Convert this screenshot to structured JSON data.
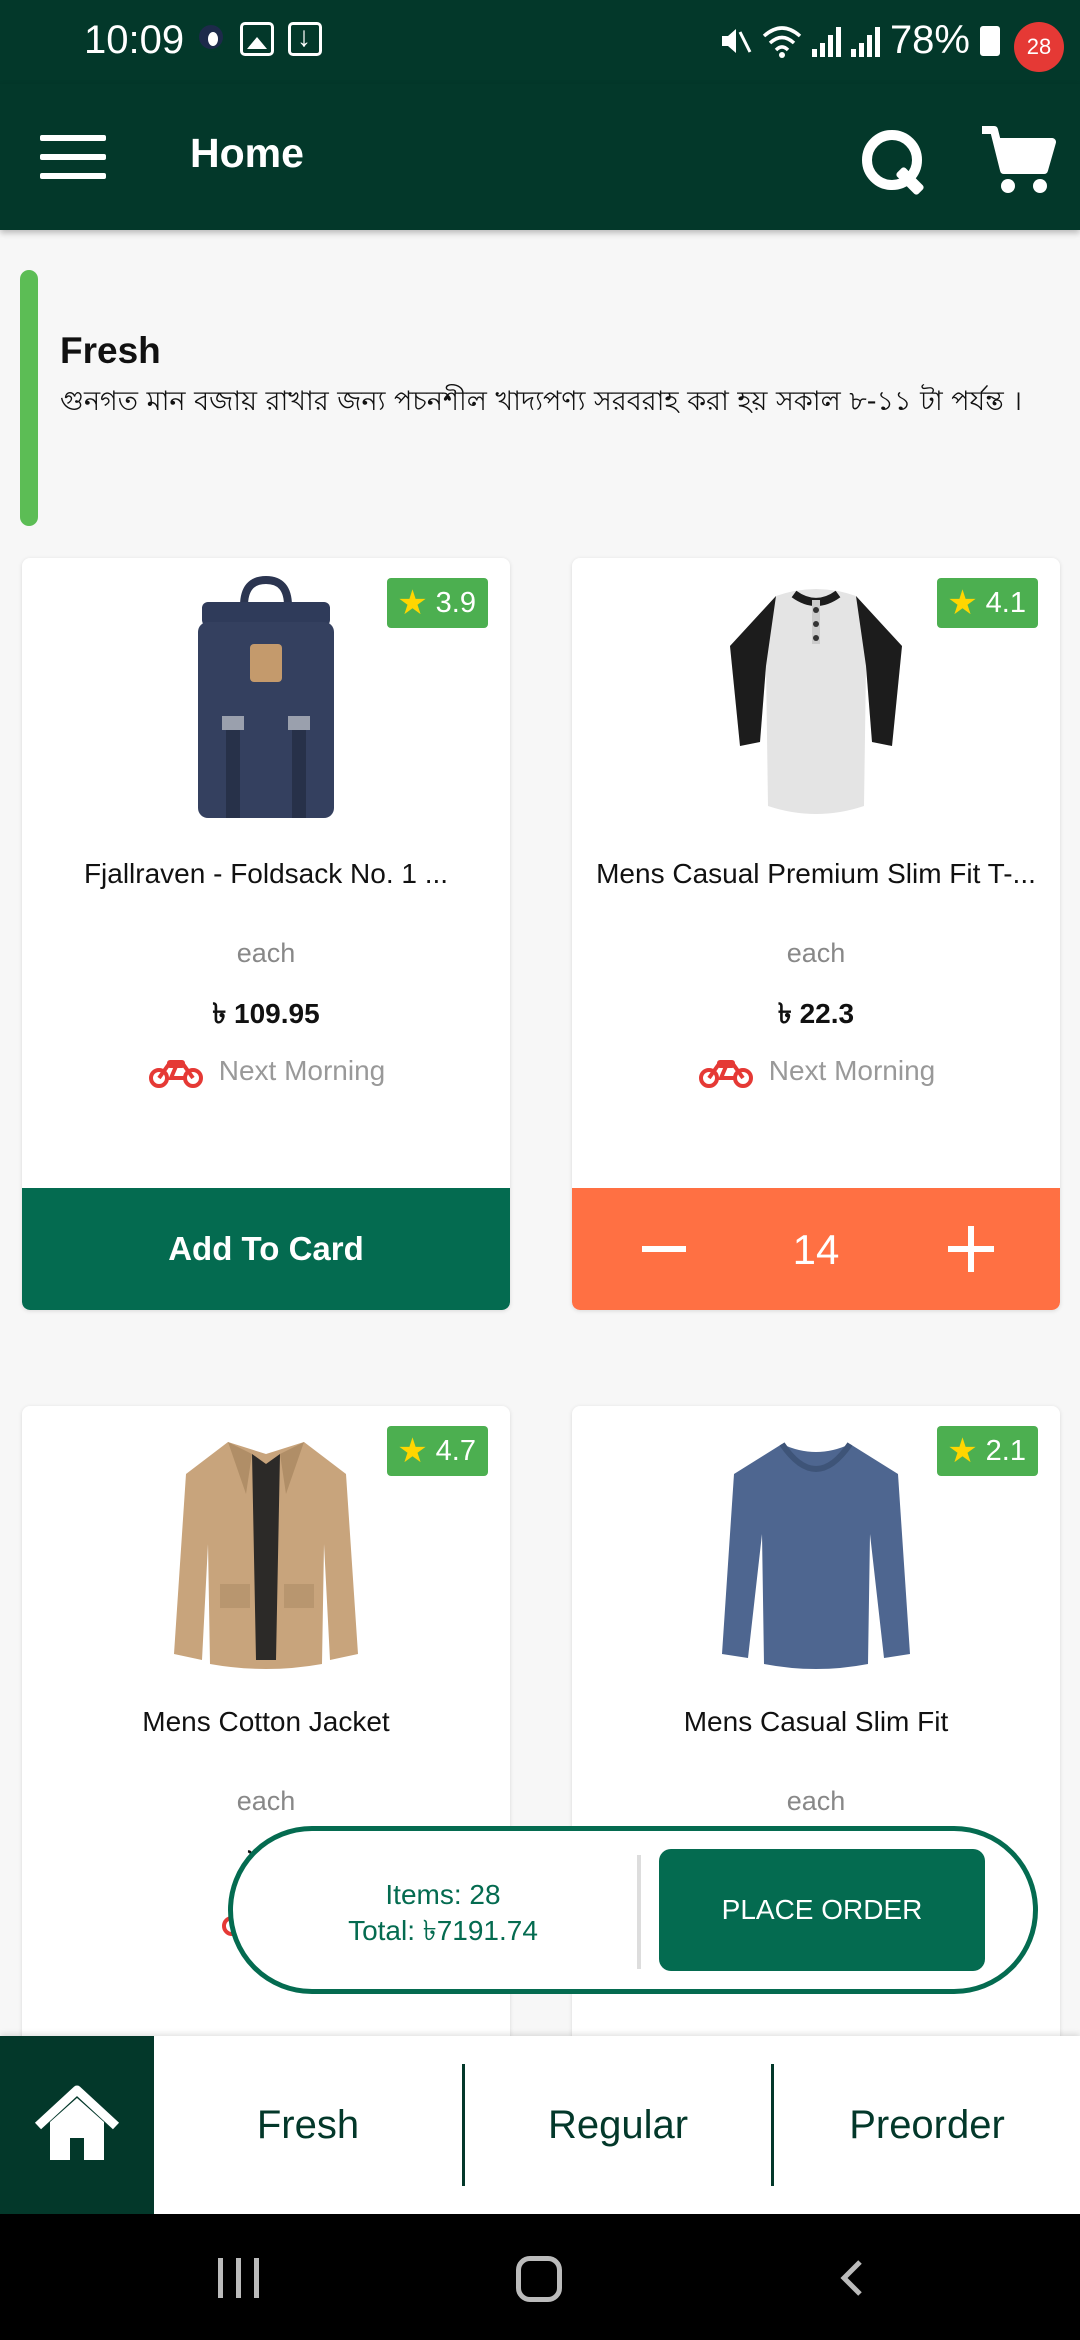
{
  "status_bar": {
    "time": "10:09",
    "battery": "78%",
    "icons": [
      "notification-dot-icon",
      "image-icon",
      "download-icon",
      "mute-icon",
      "wifi-icon",
      "signal-icon",
      "signal-icon",
      "battery-icon"
    ]
  },
  "app_bar": {
    "title": "Home",
    "cart_count": "28",
    "icons": [
      "menu-icon",
      "search-icon",
      "cart-icon"
    ]
  },
  "category": {
    "title": "Fresh",
    "description": "গুনগত মান বজায় রাখার জন্য পচনশীল খাদ্যপণ্য সরবরাহ করা হয় সকাল ৮-১১ টা পর্যন্ত ।"
  },
  "products": [
    {
      "name": "Fjallraven - Foldsack No. 1 ...",
      "rating": "3.9",
      "unit": "each",
      "price": "৳ 109.95",
      "delivery": "Next Morning",
      "action_label": "Add To Card"
    },
    {
      "name": "Mens Casual Premium Slim Fit T-...",
      "rating": "4.1",
      "unit": "each",
      "price": "৳ 22.3",
      "delivery": "Next Morning",
      "quantity": "14"
    },
    {
      "name": "Mens Cotton Jacket",
      "rating": "4.7",
      "unit": "each",
      "price_partial": "৳ 5",
      "delivery_partial": "N"
    },
    {
      "name": "Mens Casual Slim Fit",
      "rating": "2.1",
      "unit": "each"
    }
  ],
  "order_summary": {
    "items": "Items: 28",
    "total": "Total: ৳7191.74",
    "button": "PLACE ORDER"
  },
  "bottom_nav": {
    "tabs": [
      "Fresh",
      "Regular",
      "Preorder"
    ]
  },
  "colors": {
    "primary_dark": "#03382a",
    "primary": "#046b50",
    "accent_green": "#5cbd55",
    "rating_green": "#4caf50",
    "stepper_orange": "#ff7043",
    "badge_red": "#e53935"
  }
}
